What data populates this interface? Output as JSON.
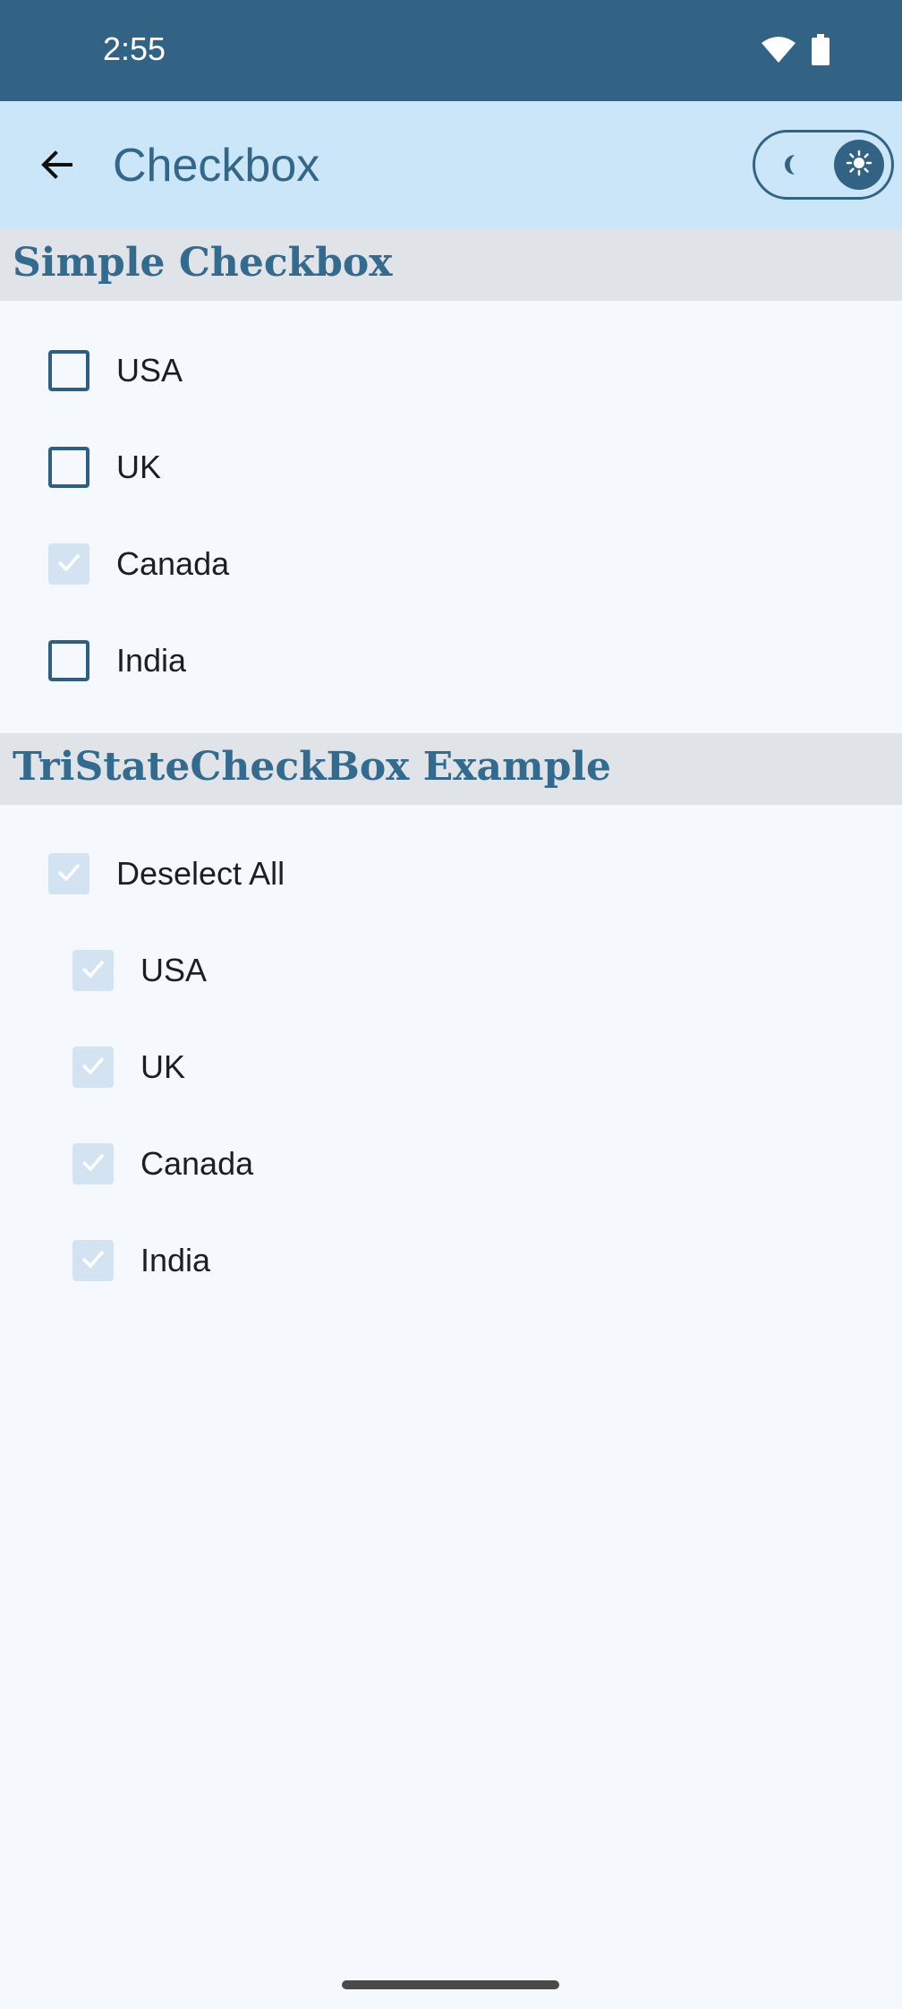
{
  "status_bar": {
    "time": "2:55",
    "icons": [
      "wifi-icon",
      "battery-icon"
    ],
    "background": "#326384"
  },
  "app_bar": {
    "title": "Checkbox",
    "back_icon": "arrow-left-icon",
    "theme_toggle": {
      "left_icon": "moon-icon",
      "right_icon": "sun-icon",
      "selected": "light"
    },
    "background": "#cbe5f9"
  },
  "simple_section": {
    "title": "Simple Checkbox",
    "items": [
      {
        "label": "USA",
        "checked": false
      },
      {
        "label": "UK",
        "checked": false
      },
      {
        "label": "Canada",
        "checked": true
      },
      {
        "label": "India",
        "checked": false
      }
    ]
  },
  "tristate_section": {
    "title": "TriStateCheckBox Example",
    "parent": {
      "label": "Deselect All",
      "checked": true
    },
    "children": [
      {
        "label": "USA",
        "checked": true
      },
      {
        "label": "UK",
        "checked": true
      },
      {
        "label": "Canada",
        "checked": true
      },
      {
        "label": "India",
        "checked": true
      }
    ]
  },
  "colors": {
    "primary": "#326384",
    "title_text": "#336689",
    "section_header_bg": "#e0e3e8",
    "page_bg": "#f5f8fd",
    "checked_fill": "#d4e3f1"
  }
}
